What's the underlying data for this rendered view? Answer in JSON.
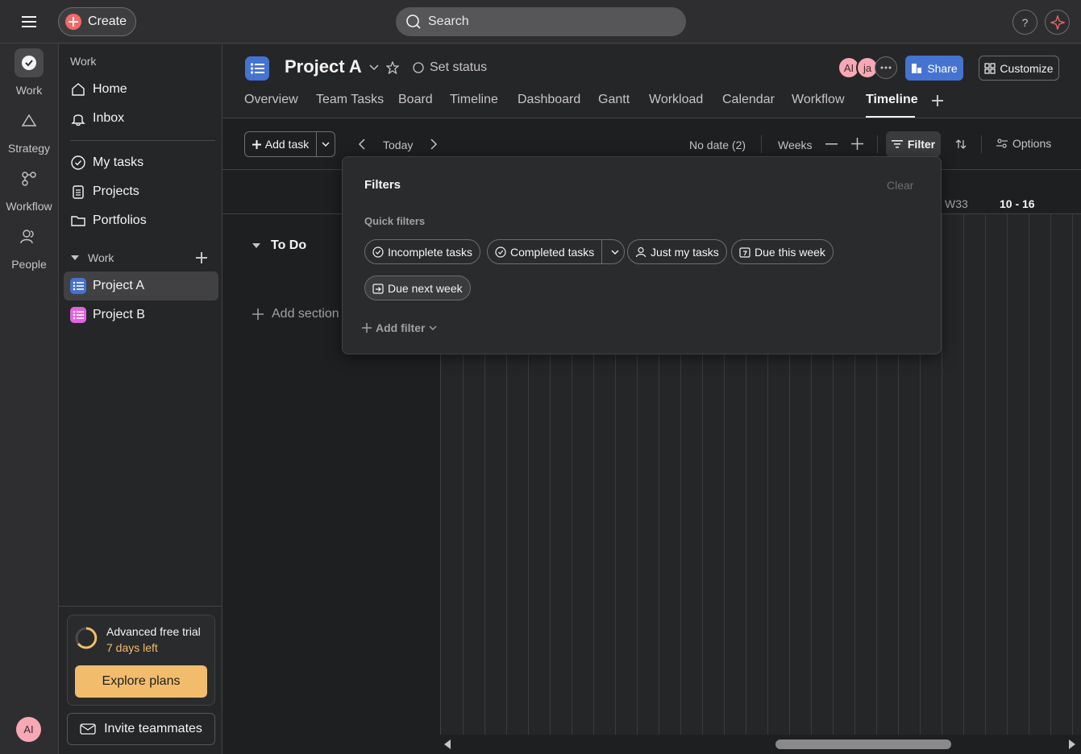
{
  "topbar": {
    "create_label": "Create",
    "search_placeholder": "Search",
    "help_label": "?"
  },
  "rail": {
    "items": [
      {
        "label": "Work",
        "icon": "check-circle-icon"
      },
      {
        "label": "Strategy",
        "icon": "triangle-icon"
      },
      {
        "label": "Workflow",
        "icon": "workflow-icon"
      },
      {
        "label": "People",
        "icon": "people-icon"
      }
    ],
    "avatar_initials": "AI"
  },
  "sidebar": {
    "section_label": "Work",
    "nav": [
      {
        "label": "Home",
        "icon": "home-icon"
      },
      {
        "label": "Inbox",
        "icon": "bell-icon"
      }
    ],
    "nav2": [
      {
        "label": "My tasks",
        "icon": "check-circle-icon"
      },
      {
        "label": "Projects",
        "icon": "clipboard-icon"
      },
      {
        "label": "Portfolios",
        "icon": "folder-icon"
      }
    ],
    "work_group_label": "Work",
    "projects": [
      {
        "label": "Project A",
        "color": "#4573d2"
      },
      {
        "label": "Project B",
        "color": "#e362e3"
      }
    ],
    "trial": {
      "title": "Advanced free trial",
      "days_left": "7 days left",
      "explore_label": "Explore plans"
    },
    "invite_label": "Invite teammates"
  },
  "project": {
    "title": "Project A",
    "set_status": "Set status",
    "members": [
      "AI",
      "ja"
    ],
    "share_label": "Share",
    "customize_label": "Customize",
    "tabs": [
      "Overview",
      "Team Tasks",
      "Board",
      "Timeline",
      "Dashboard",
      "Gantt",
      "Workload",
      "Calendar",
      "Workflow",
      "Timeline"
    ],
    "active_tab_index": 9
  },
  "toolbar": {
    "add_task_label": "Add task",
    "today_label": "Today",
    "no_date_label": "No date (2)",
    "weeks_label": "Weeks",
    "filter_label": "Filter",
    "options_label": "Options"
  },
  "timeline": {
    "week_label": "W33",
    "week_range": "10 - 16",
    "section_label": "To Do",
    "add_section_label": "Add section"
  },
  "filter_popup": {
    "title": "Filters",
    "clear_label": "Clear",
    "quick_filters_label": "Quick filters",
    "chips": [
      {
        "label": "Incomplete tasks",
        "icon": "check-circle-icon"
      },
      {
        "label": "Completed tasks",
        "icon": "check-circle-icon"
      },
      {
        "label": "Just my tasks",
        "icon": "person-icon"
      },
      {
        "label": "Due this week",
        "icon": "calendar-7-icon"
      },
      {
        "label": "Due next week",
        "icon": "calendar-next-icon"
      }
    ],
    "add_filter_label": "Add filter"
  }
}
